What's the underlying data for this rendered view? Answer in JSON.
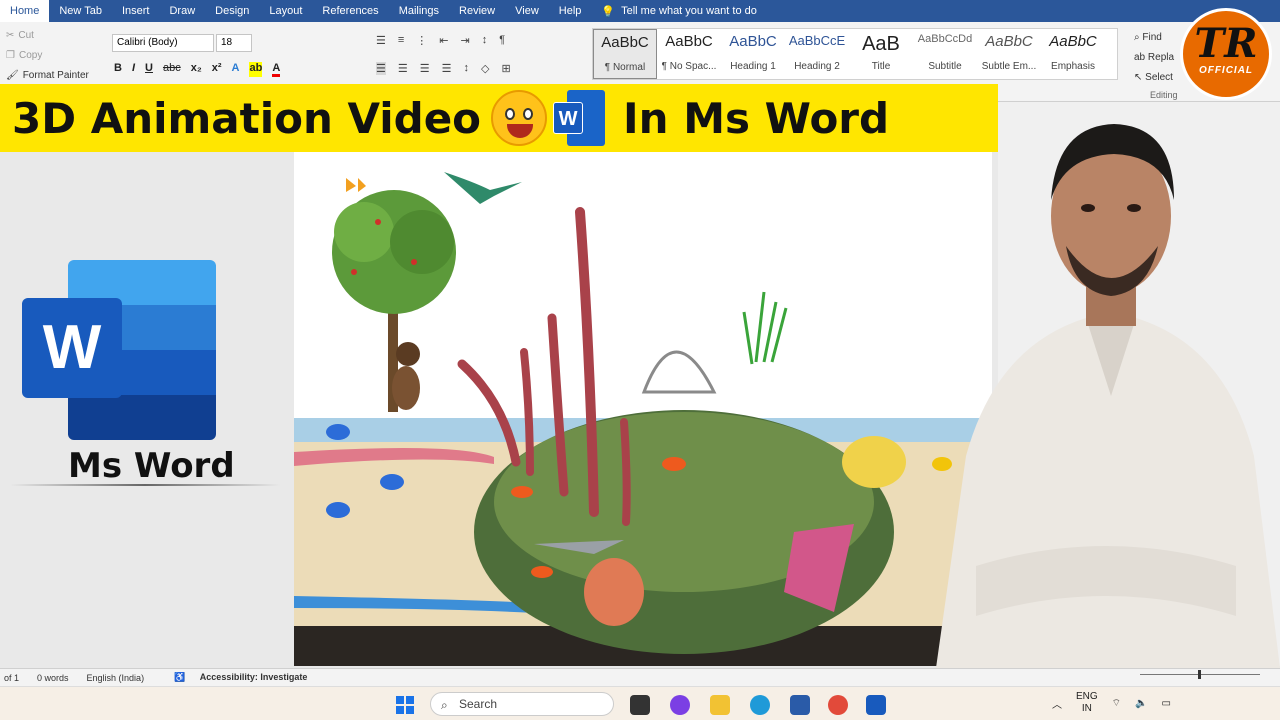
{
  "ribbon_tabs": [
    "Home",
    "New Tab",
    "Insert",
    "Draw",
    "Design",
    "Layout",
    "References",
    "Mailings",
    "Review",
    "View",
    "Help"
  ],
  "tell_me": "Tell me what you want to do",
  "clipboard": {
    "cut": "Cut",
    "copy": "Copy",
    "format_painter": "Format Painter"
  },
  "font": {
    "name": "Calibri (Body)",
    "size": "18"
  },
  "styles": [
    {
      "preview": "AaBbC",
      "name": "¶ Normal"
    },
    {
      "preview": "AaBbC",
      "name": "¶ No Spac..."
    },
    {
      "preview": "AaBbC",
      "name": "Heading 1"
    },
    {
      "preview": "AaBbCcE",
      "name": "Heading 2"
    },
    {
      "preview": "AaB",
      "name": "Title"
    },
    {
      "preview": "AaBbCcDd",
      "name": "Subtitle"
    },
    {
      "preview": "AaBbC",
      "name": "Subtle Em..."
    },
    {
      "preview": "AaBbC",
      "name": "Emphasis"
    }
  ],
  "editing": {
    "find": "Find",
    "replace": "Repla",
    "select": "Select",
    "group": "Editing"
  },
  "banner": {
    "part1": "3D Animation Video",
    "part2": "In Ms Word",
    "word_letter": "W"
  },
  "left_logo": {
    "letter": "W",
    "caption": "Ms Word"
  },
  "channel_logo": {
    "initials": "TR",
    "sub": "OFFICIAL"
  },
  "status": {
    "page": "of 1",
    "words": "0 words",
    "language": "English (India)",
    "accessibility": "Accessibility: Investigate"
  },
  "taskbar": {
    "search": "Search",
    "lang1": "ENG",
    "lang2": "IN"
  },
  "colors": {
    "word_blue": "#2b579a",
    "banner_yellow": "#ffe600",
    "logo_orange": "#e86a00"
  }
}
